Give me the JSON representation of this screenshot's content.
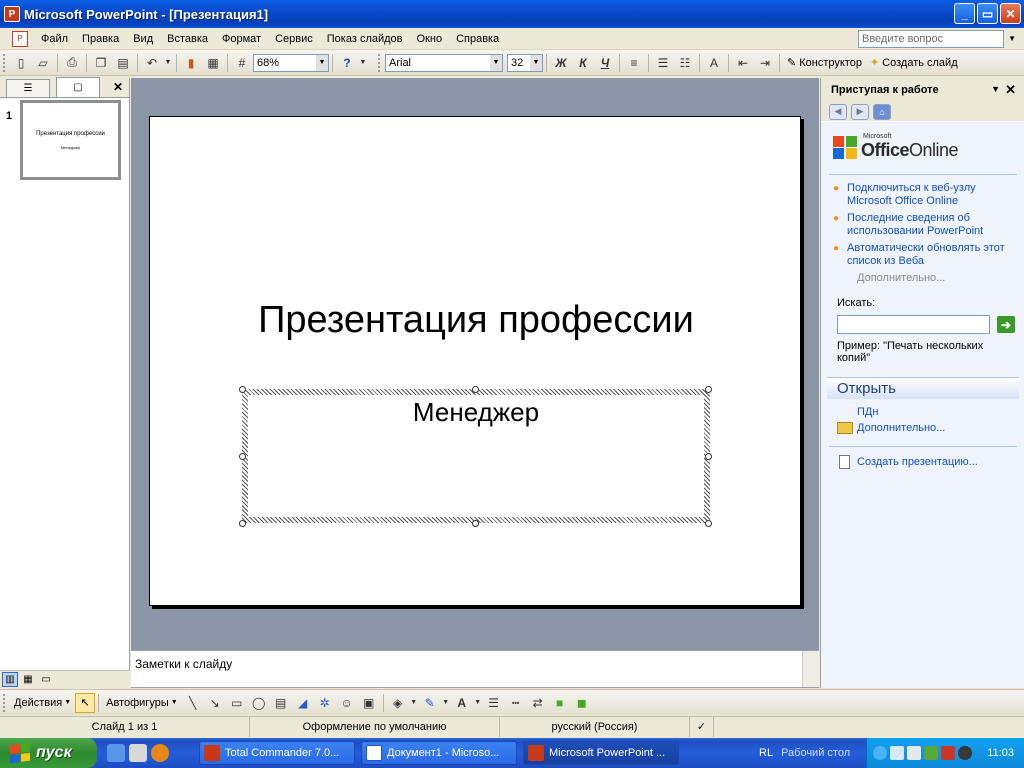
{
  "window": {
    "title": "Microsoft PowerPoint - [Презентация1]",
    "minimize": "_",
    "maximize": "▭",
    "close": "✕"
  },
  "menu": {
    "items": [
      "Файл",
      "Правка",
      "Вид",
      "Вставка",
      "Формат",
      "Сервис",
      "Показ слайдов",
      "Окно",
      "Справка"
    ],
    "help_placeholder": "Введите вопрос"
  },
  "toolbar": {
    "zoom": "68%",
    "font": "Arial",
    "font_size": "32",
    "bold": "Ж",
    "italic": "К",
    "underline": "Ч",
    "designer": "Конструктор",
    "new_slide": "Создать слайд"
  },
  "slides_pane": {
    "slide_number": "1",
    "thumb_title": "Презентация профессии",
    "thumb_subtitle": "Менеджер"
  },
  "slide": {
    "title": "Презентация профессии",
    "subtitle": "Менеджер"
  },
  "notes": {
    "placeholder": "Заметки к слайду"
  },
  "taskpane": {
    "title": "Приступая к работе",
    "logo_small": "Microsoft",
    "logo_office": "Office",
    "logo_online": "Online",
    "links": [
      "Подключиться к веб-узлу Microsoft Office Online",
      "Последние сведения об использовании PowerPoint",
      "Автоматически обновлять этот список из Веба"
    ],
    "more": "Дополнительно...",
    "search_label": "Искать:",
    "example_label": "Пример:",
    "example_text": "\"Печать нескольких копий\"",
    "open_section": "Открыть",
    "open_file": "ПДн",
    "open_more": "Дополнительно...",
    "create": "Создать презентацию..."
  },
  "drawbar": {
    "actions": "Действия",
    "autoshapes": "Автофигуры"
  },
  "status": {
    "slide": "Слайд 1 из 1",
    "design": "Оформление по умолчанию",
    "language": "русский (Россия)"
  },
  "taskbar": {
    "start": "пуск",
    "tasks": [
      "Total Commander 7.0...",
      "Документ1 - Microso...",
      "Microsoft PowerPoint ..."
    ],
    "lang": "RL",
    "desktop": "Рабочий стол",
    "clock": "11:03"
  },
  "colors": {
    "accent_blue": "#0a5fe6",
    "link_blue": "#1550bb",
    "bullet_orange": "#f09018",
    "workspace_gray": "#8c96a8"
  }
}
